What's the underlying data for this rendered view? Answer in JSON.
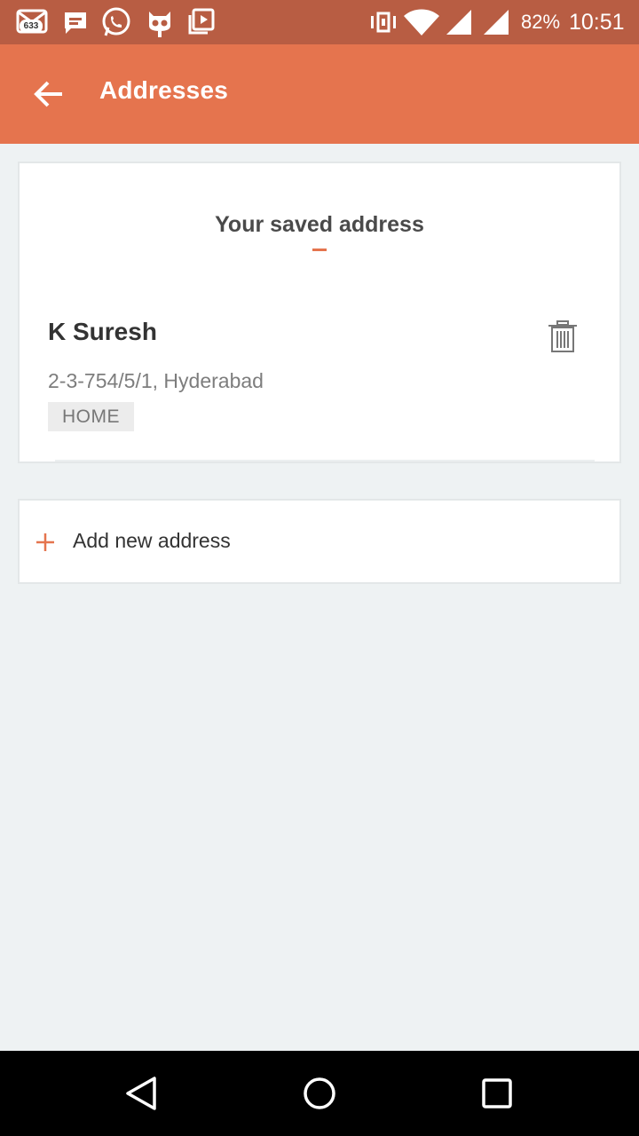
{
  "status_bar": {
    "notification_badge": "633",
    "battery": "82%",
    "time": "10:51",
    "icons": [
      "mail-icon",
      "chat-icon",
      "whatsapp-icon",
      "cyanogen-icon",
      "video-icon",
      "vibrate-icon",
      "wifi-icon",
      "signal-icon",
      "signal-icon"
    ]
  },
  "app_bar": {
    "title": "Addresses",
    "back_icon": "arrow-back-icon",
    "color": "#e5744e"
  },
  "saved_section": {
    "title": "Your saved address",
    "addresses": [
      {
        "name": "K Suresh",
        "line": "2-3-754/5/1, Hyderabad",
        "tag": "HOME",
        "delete_icon": "trash-icon"
      }
    ]
  },
  "add_address": {
    "label": "Add new address",
    "icon": "plus-icon"
  },
  "nav_bar": {
    "icons": [
      "back-triangle-icon",
      "home-circle-icon",
      "recents-square-icon"
    ]
  },
  "colors": {
    "accent": "#e5744e",
    "status_bar": "#b85d43",
    "background": "#eef2f3"
  }
}
